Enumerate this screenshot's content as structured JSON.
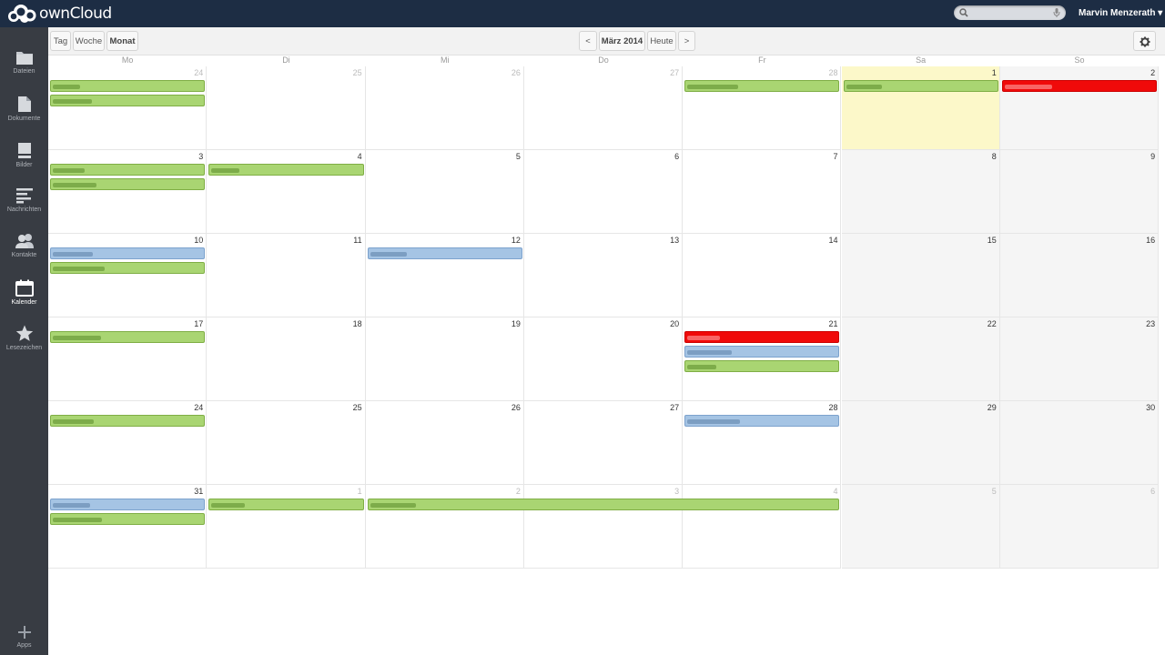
{
  "header": {
    "logo_text": "ownCloud",
    "user_name": "Marvin Menzerath ▾"
  },
  "nav": [
    {
      "label": "Dateien",
      "icon": "folder-icon"
    },
    {
      "label": "Dokumente",
      "icon": "document-icon"
    },
    {
      "label": "Bilder",
      "icon": "image-icon"
    },
    {
      "label": "Nachrichten",
      "icon": "news-icon"
    },
    {
      "label": "Kontakte",
      "icon": "contacts-icon"
    },
    {
      "label": "Kalender",
      "icon": "calendar-icon",
      "active": true
    },
    {
      "label": "Lesezeichen",
      "icon": "star-icon"
    },
    {
      "label": "Apps",
      "icon": "plus-icon"
    }
  ],
  "toolbar": {
    "views": [
      "Tag",
      "Woche",
      "Monat"
    ],
    "active_view": "Monat",
    "prev": "<",
    "title": "März 2014",
    "today": "Heute",
    "next": ">",
    "settings_icon": "gear-icon"
  },
  "calendar": {
    "weekdays": [
      "Mo",
      "Di",
      "Mi",
      "Do",
      "Fr",
      "Sa",
      "So"
    ],
    "weeks": [
      [
        24,
        25,
        26,
        27,
        28,
        1,
        2
      ],
      [
        3,
        4,
        5,
        6,
        7,
        8,
        9
      ],
      [
        10,
        11,
        12,
        13,
        14,
        15,
        16
      ],
      [
        17,
        18,
        19,
        20,
        21,
        22,
        23
      ],
      [
        24,
        25,
        26,
        27,
        28,
        29,
        30
      ],
      [
        31,
        1,
        2,
        3,
        4,
        5,
        6
      ]
    ],
    "today": "1",
    "colors": {
      "green": "#a9d572",
      "blue": "#a5c4e4",
      "red": "#f00a0a",
      "today": "#fcf8c9"
    },
    "events": [
      {
        "week": 0,
        "day": 0,
        "span": 1,
        "color": "green"
      },
      {
        "week": 0,
        "day": 0,
        "span": 1,
        "color": "green"
      },
      {
        "week": 0,
        "day": 4,
        "span": 1,
        "color": "green"
      },
      {
        "week": 0,
        "day": 5,
        "span": 1,
        "color": "green"
      },
      {
        "week": 0,
        "day": 6,
        "span": 1,
        "color": "red"
      },
      {
        "week": 1,
        "day": 0,
        "span": 1,
        "color": "green"
      },
      {
        "week": 1,
        "day": 0,
        "span": 1,
        "color": "green"
      },
      {
        "week": 1,
        "day": 1,
        "span": 1,
        "color": "green"
      },
      {
        "week": 2,
        "day": 0,
        "span": 1,
        "color": "blue"
      },
      {
        "week": 2,
        "day": 0,
        "span": 1,
        "color": "green"
      },
      {
        "week": 2,
        "day": 2,
        "span": 1,
        "color": "blue"
      },
      {
        "week": 3,
        "day": 0,
        "span": 1,
        "color": "green"
      },
      {
        "week": 3,
        "day": 4,
        "span": 1,
        "color": "red"
      },
      {
        "week": 3,
        "day": 4,
        "span": 1,
        "color": "blue"
      },
      {
        "week": 3,
        "day": 4,
        "span": 1,
        "color": "green"
      },
      {
        "week": 4,
        "day": 0,
        "span": 1,
        "color": "green"
      },
      {
        "week": 4,
        "day": 4,
        "span": 1,
        "color": "blue"
      },
      {
        "week": 5,
        "day": 0,
        "span": 1,
        "color": "blue"
      },
      {
        "week": 5,
        "day": 0,
        "span": 1,
        "color": "green"
      },
      {
        "week": 5,
        "day": 1,
        "span": 1,
        "color": "green"
      },
      {
        "week": 5,
        "day": 2,
        "span": 3,
        "color": "green"
      }
    ]
  }
}
